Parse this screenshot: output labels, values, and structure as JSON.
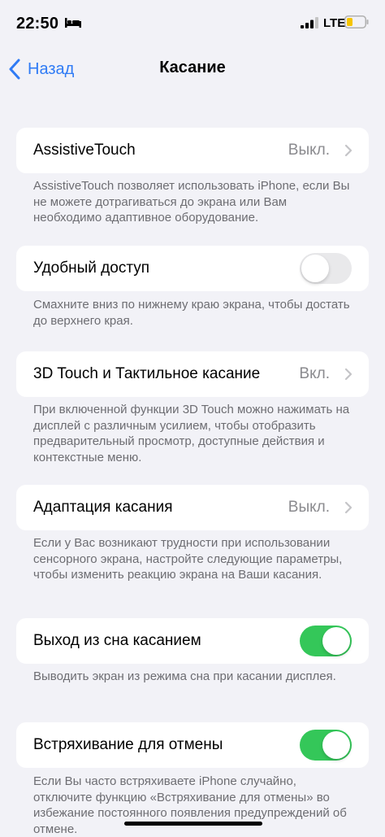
{
  "status_bar": {
    "time": "22:50",
    "network": "LTE",
    "icons": [
      "bed-icon",
      "signal-icon",
      "battery-icon"
    ],
    "battery_color": "#f5c400"
  },
  "nav": {
    "back_label": "Назад",
    "title": "Касание"
  },
  "colors": {
    "accent": "#2f7bf5",
    "toggle_on": "#34c759",
    "toggle_off": "#e9e9eb"
  },
  "settings": [
    {
      "label": "AssistiveTouch",
      "value": "Выкл.",
      "footer": "AssistiveTouch позволяет использовать iPhone, если Вы не можете дотрагиваться до экрана или Вам необходимо адаптивное оборудование."
    },
    {
      "label": "Удобный доступ",
      "toggle": false,
      "footer": "Смахните вниз по нижнему краю экрана, чтобы достать до верхнего края."
    },
    {
      "label": "3D Touch и Тактильное касание",
      "value": "Вкл.",
      "footer": "При включенной функции 3D Touch можно нажимать на дисплей с различным усилием, чтобы отобразить предварительный просмотр, доступные действия и контекстные меню."
    },
    {
      "label": "Адаптация касания",
      "value": "Выкл.",
      "footer": "Если у Вас возникают трудности при использовании сенсорного экрана, настройте следующие параметры, чтобы изменить реакцию экрана на Ваши касания."
    },
    {
      "label": "Выход из сна касанием",
      "toggle": true,
      "footer": "Выводить экран из режима сна при касании дисплея."
    },
    {
      "label": "Встряхивание для отмены",
      "toggle": true,
      "footer": "Если Вы часто встряхиваете iPhone случайно, отключите функцию «Встряхивание для отмены» во избежание постоянного появления предупреждений об отмене."
    }
  ]
}
